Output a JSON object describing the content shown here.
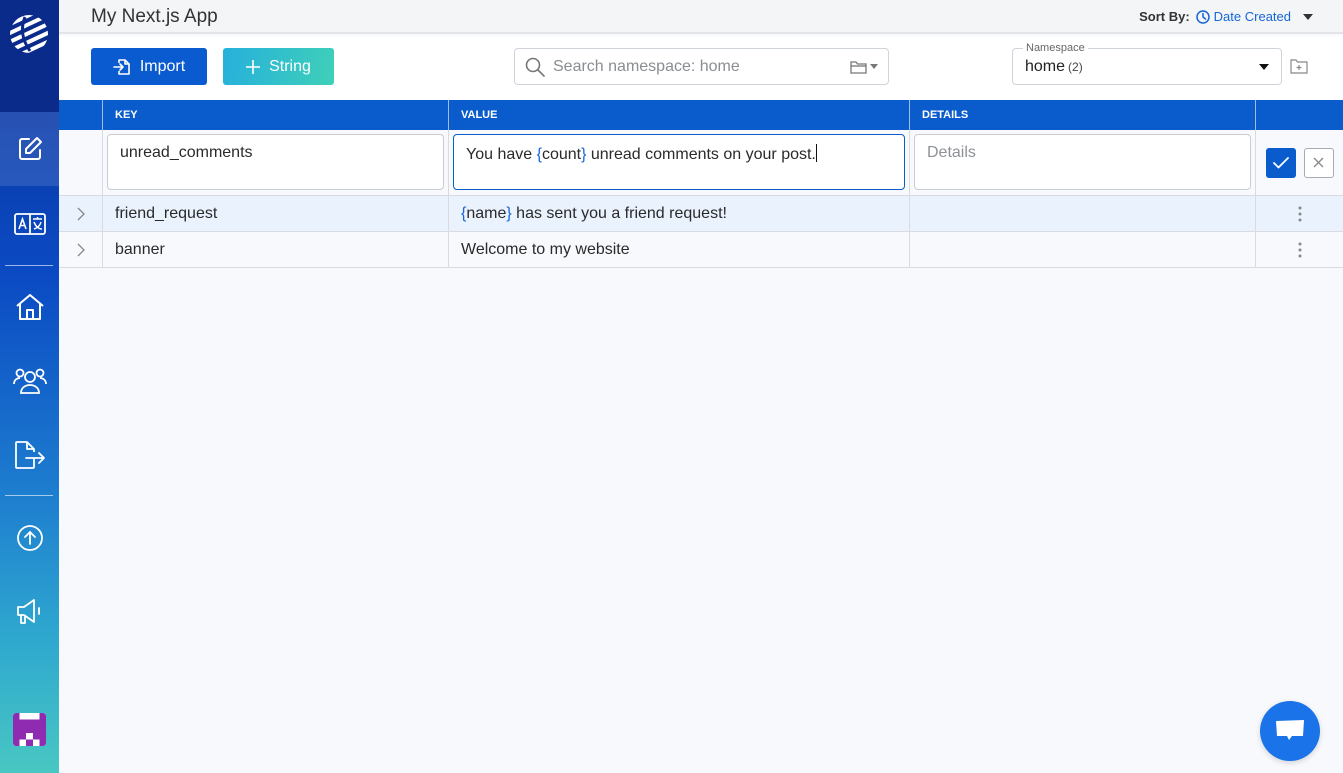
{
  "app": {
    "title": "My Next.js App"
  },
  "sort": {
    "label": "Sort By:",
    "value": "Date Created",
    "icon": "clock-icon"
  },
  "toolbar": {
    "import_label": "Import",
    "add_string_label": "String",
    "search_placeholder": "Search namespace: home",
    "search_value": ""
  },
  "namespace": {
    "label": "Namespace",
    "value": "home",
    "count": "(2)"
  },
  "sidebar": {
    "items": [
      {
        "name": "editor",
        "icon": "edit-icon",
        "active": true
      },
      {
        "name": "translations",
        "icon": "translate-icon",
        "active": false
      },
      {
        "name": "home",
        "icon": "home-icon",
        "active": false
      },
      {
        "name": "team",
        "icon": "users-icon",
        "active": false
      },
      {
        "name": "export",
        "icon": "file-export-icon",
        "active": false
      },
      {
        "name": "upgrade",
        "icon": "arrow-up-circle-icon",
        "active": false
      },
      {
        "name": "announcements",
        "icon": "megaphone-icon",
        "active": false
      }
    ]
  },
  "table": {
    "headers": [
      "KEY",
      "VALUE",
      "DETAILS"
    ],
    "edit_row": {
      "key": "unread_comments",
      "value_parts": [
        {
          "text": "You have ",
          "var": false
        },
        {
          "text": "{",
          "var": true
        },
        {
          "text": "count",
          "var": false
        },
        {
          "text": "}",
          "var": true
        },
        {
          "text": " unread comments on your post.",
          "var": false
        }
      ],
      "details_placeholder": "Details"
    },
    "rows": [
      {
        "key": "friend_request",
        "value_parts": [
          {
            "text": "{",
            "var": true
          },
          {
            "text": "name",
            "var": false
          },
          {
            "text": "}",
            "var": true
          },
          {
            "text": " has sent you a friend request!",
            "var": false
          }
        ],
        "details": ""
      },
      {
        "key": "banner",
        "value_parts": [
          {
            "text": "Welcome to my website",
            "var": false
          }
        ],
        "details": ""
      }
    ]
  },
  "colors": {
    "primary": "#0a5ccc",
    "accent_link": "#1565d8",
    "row_highlight": "#eaf2fe",
    "chat": "#1a73e8"
  }
}
